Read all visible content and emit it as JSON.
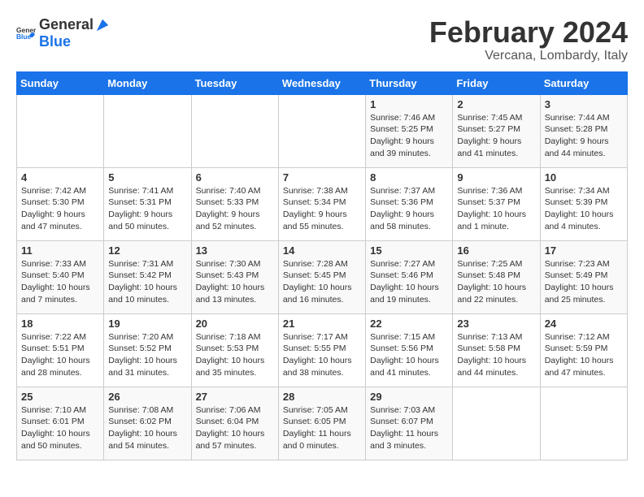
{
  "header": {
    "logo_general": "General",
    "logo_blue": "Blue",
    "month": "February 2024",
    "location": "Vercana, Lombardy, Italy"
  },
  "weekdays": [
    "Sunday",
    "Monday",
    "Tuesday",
    "Wednesday",
    "Thursday",
    "Friday",
    "Saturday"
  ],
  "weeks": [
    [
      {
        "day": "",
        "info": ""
      },
      {
        "day": "",
        "info": ""
      },
      {
        "day": "",
        "info": ""
      },
      {
        "day": "",
        "info": ""
      },
      {
        "day": "1",
        "info": "Sunrise: 7:46 AM\nSunset: 5:25 PM\nDaylight: 9 hours\nand 39 minutes."
      },
      {
        "day": "2",
        "info": "Sunrise: 7:45 AM\nSunset: 5:27 PM\nDaylight: 9 hours\nand 41 minutes."
      },
      {
        "day": "3",
        "info": "Sunrise: 7:44 AM\nSunset: 5:28 PM\nDaylight: 9 hours\nand 44 minutes."
      }
    ],
    [
      {
        "day": "4",
        "info": "Sunrise: 7:42 AM\nSunset: 5:30 PM\nDaylight: 9 hours\nand 47 minutes."
      },
      {
        "day": "5",
        "info": "Sunrise: 7:41 AM\nSunset: 5:31 PM\nDaylight: 9 hours\nand 50 minutes."
      },
      {
        "day": "6",
        "info": "Sunrise: 7:40 AM\nSunset: 5:33 PM\nDaylight: 9 hours\nand 52 minutes."
      },
      {
        "day": "7",
        "info": "Sunrise: 7:38 AM\nSunset: 5:34 PM\nDaylight: 9 hours\nand 55 minutes."
      },
      {
        "day": "8",
        "info": "Sunrise: 7:37 AM\nSunset: 5:36 PM\nDaylight: 9 hours\nand 58 minutes."
      },
      {
        "day": "9",
        "info": "Sunrise: 7:36 AM\nSunset: 5:37 PM\nDaylight: 10 hours\nand 1 minute."
      },
      {
        "day": "10",
        "info": "Sunrise: 7:34 AM\nSunset: 5:39 PM\nDaylight: 10 hours\nand 4 minutes."
      }
    ],
    [
      {
        "day": "11",
        "info": "Sunrise: 7:33 AM\nSunset: 5:40 PM\nDaylight: 10 hours\nand 7 minutes."
      },
      {
        "day": "12",
        "info": "Sunrise: 7:31 AM\nSunset: 5:42 PM\nDaylight: 10 hours\nand 10 minutes."
      },
      {
        "day": "13",
        "info": "Sunrise: 7:30 AM\nSunset: 5:43 PM\nDaylight: 10 hours\nand 13 minutes."
      },
      {
        "day": "14",
        "info": "Sunrise: 7:28 AM\nSunset: 5:45 PM\nDaylight: 10 hours\nand 16 minutes."
      },
      {
        "day": "15",
        "info": "Sunrise: 7:27 AM\nSunset: 5:46 PM\nDaylight: 10 hours\nand 19 minutes."
      },
      {
        "day": "16",
        "info": "Sunrise: 7:25 AM\nSunset: 5:48 PM\nDaylight: 10 hours\nand 22 minutes."
      },
      {
        "day": "17",
        "info": "Sunrise: 7:23 AM\nSunset: 5:49 PM\nDaylight: 10 hours\nand 25 minutes."
      }
    ],
    [
      {
        "day": "18",
        "info": "Sunrise: 7:22 AM\nSunset: 5:51 PM\nDaylight: 10 hours\nand 28 minutes."
      },
      {
        "day": "19",
        "info": "Sunrise: 7:20 AM\nSunset: 5:52 PM\nDaylight: 10 hours\nand 31 minutes."
      },
      {
        "day": "20",
        "info": "Sunrise: 7:18 AM\nSunset: 5:53 PM\nDaylight: 10 hours\nand 35 minutes."
      },
      {
        "day": "21",
        "info": "Sunrise: 7:17 AM\nSunset: 5:55 PM\nDaylight: 10 hours\nand 38 minutes."
      },
      {
        "day": "22",
        "info": "Sunrise: 7:15 AM\nSunset: 5:56 PM\nDaylight: 10 hours\nand 41 minutes."
      },
      {
        "day": "23",
        "info": "Sunrise: 7:13 AM\nSunset: 5:58 PM\nDaylight: 10 hours\nand 44 minutes."
      },
      {
        "day": "24",
        "info": "Sunrise: 7:12 AM\nSunset: 5:59 PM\nDaylight: 10 hours\nand 47 minutes."
      }
    ],
    [
      {
        "day": "25",
        "info": "Sunrise: 7:10 AM\nSunset: 6:01 PM\nDaylight: 10 hours\nand 50 minutes."
      },
      {
        "day": "26",
        "info": "Sunrise: 7:08 AM\nSunset: 6:02 PM\nDaylight: 10 hours\nand 54 minutes."
      },
      {
        "day": "27",
        "info": "Sunrise: 7:06 AM\nSunset: 6:04 PM\nDaylight: 10 hours\nand 57 minutes."
      },
      {
        "day": "28",
        "info": "Sunrise: 7:05 AM\nSunset: 6:05 PM\nDaylight: 11 hours\nand 0 minutes."
      },
      {
        "day": "29",
        "info": "Sunrise: 7:03 AM\nSunset: 6:07 PM\nDaylight: 11 hours\nand 3 minutes."
      },
      {
        "day": "",
        "info": ""
      },
      {
        "day": "",
        "info": ""
      }
    ]
  ]
}
